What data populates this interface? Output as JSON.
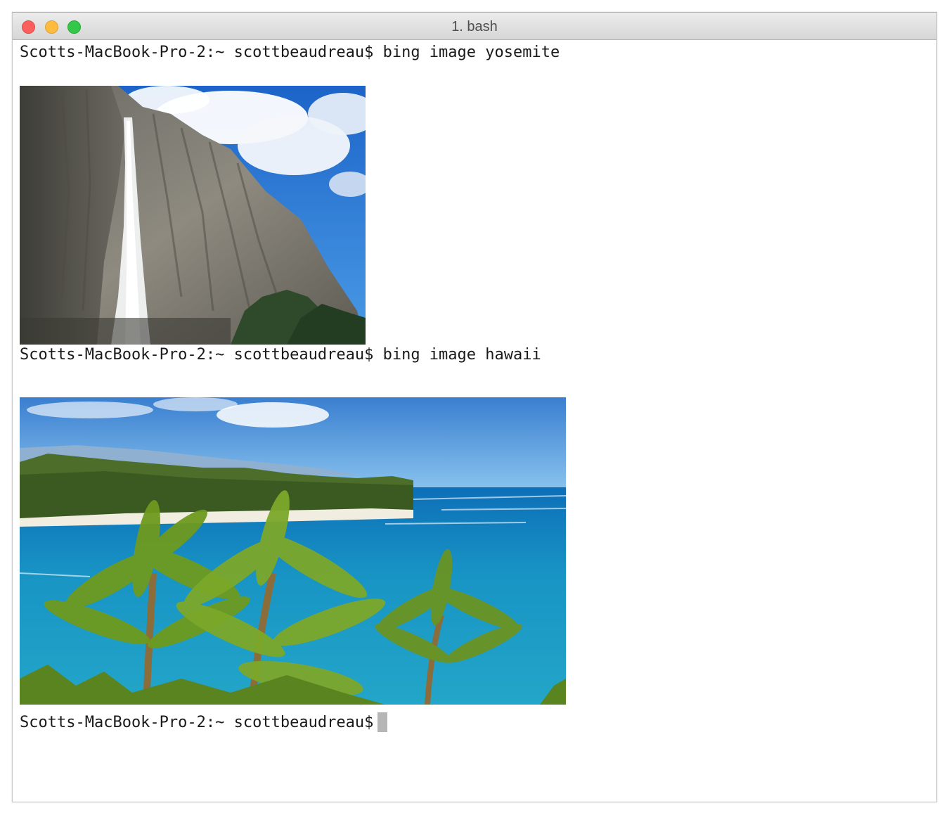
{
  "window": {
    "title": "1. bash"
  },
  "terminal": {
    "lines": [
      {
        "prompt": "Scotts-MacBook-Pro-2:~ scottbeaudreau$",
        "command": "bing image yosemite"
      },
      {
        "prompt": "Scotts-MacBook-Pro-2:~ scottbeaudreau$",
        "command": "bing image hawaii"
      },
      {
        "prompt": "Scotts-MacBook-Pro-2:~ scottbeaudreau$",
        "command": ""
      }
    ],
    "images": [
      {
        "subject": "yosemite-waterfall-photo"
      },
      {
        "subject": "hawaii-beach-palms-photo"
      }
    ]
  },
  "colors": {
    "close": "#fc605c",
    "minimize": "#fdbc40",
    "zoom": "#34c84a",
    "cursor": "#b6b6b6"
  }
}
